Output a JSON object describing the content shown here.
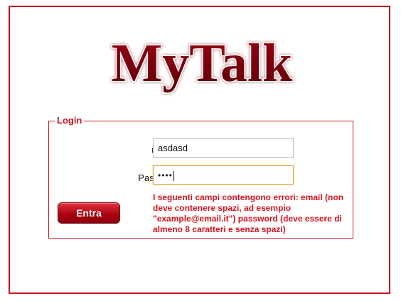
{
  "brand": {
    "logo_text": "MyTalk",
    "color": "#a00010"
  },
  "login": {
    "legend": "Login",
    "user_label": "Utente:",
    "user_value": "asdasd",
    "password_label": "Password:",
    "password_mask": "••••",
    "submit_label": "Entra",
    "error_message": "I seguenti campi contengono errori: email (non deve contenere spazi, ad esempio \"example@email.it\") password (deve essere di almeno 8 caratteri e senza spazi)"
  },
  "colors": {
    "accent": "#c8141e",
    "error": "#d4141e",
    "focus_border": "#d9a93a"
  }
}
